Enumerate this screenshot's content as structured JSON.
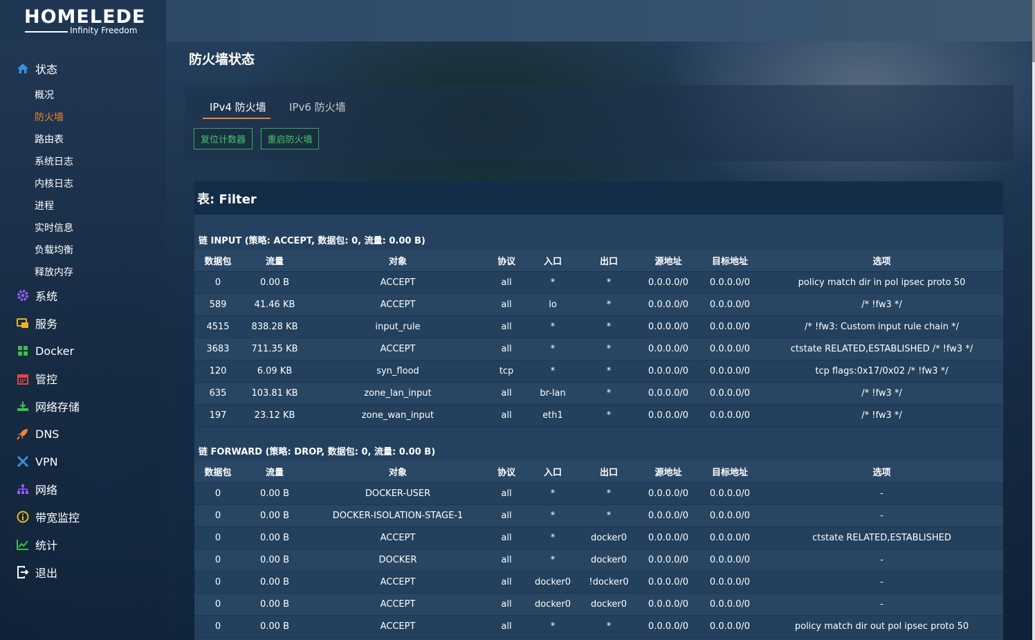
{
  "brand": {
    "name": "HOMELEDE",
    "tagline": "Infinity Freedom"
  },
  "sidebar": {
    "status": {
      "label": "状态",
      "items": [
        "概况",
        "防火墙",
        "路由表",
        "系统日志",
        "内核日志",
        "进程",
        "实时信息",
        "负载均衡",
        "释放内存"
      ],
      "active_index": 1
    },
    "menu": [
      {
        "label": "系统",
        "icon": "gear-icon",
        "color": "#9b59ff"
      },
      {
        "label": "服务",
        "icon": "services-icon",
        "color": "#f0b429"
      },
      {
        "label": "Docker",
        "icon": "docker-icon",
        "color": "#3fbf4a"
      },
      {
        "label": "管控",
        "icon": "calendar-icon",
        "color": "#e64545"
      },
      {
        "label": "网络存储",
        "icon": "download-icon",
        "color": "#3fbf4a"
      },
      {
        "label": "DNS",
        "icon": "rocket-icon",
        "color": "#f0852c"
      },
      {
        "label": "VPN",
        "icon": "vpn-icon",
        "color": "#3b8fe0"
      },
      {
        "label": "网络",
        "icon": "network-icon",
        "color": "#9b59ff"
      },
      {
        "label": "带宽监控",
        "icon": "info-circle-icon",
        "color": "#f0b429"
      },
      {
        "label": "统计",
        "icon": "chart-line-icon",
        "color": "#3fbf4a"
      },
      {
        "label": "退出",
        "icon": "logout-icon",
        "color": "#ffffff"
      }
    ]
  },
  "page": {
    "title": "防火墙状态",
    "tabs": [
      "IPv4 防火墙",
      "IPv6 防火墙"
    ],
    "active_tab": 0,
    "buttons": {
      "reset_counters": "复位计数器",
      "restart_firewall": "重启防火墙"
    },
    "table_title": "表: Filter"
  },
  "columns": [
    "数据包",
    "流量",
    "对象",
    "协议",
    "入口",
    "出口",
    "源地址",
    "目标地址",
    "选项"
  ],
  "chains": [
    {
      "title": "链 INPUT (策略: ACCEPT, 数据包: 0, 流量: 0.00 B)",
      "rows": [
        [
          "0",
          "0.00 B",
          "ACCEPT",
          "all",
          "*",
          "*",
          "0.0.0.0/0",
          "0.0.0.0/0",
          "policy match dir in pol ipsec proto 50"
        ],
        [
          "589",
          "41.46 KB",
          "ACCEPT",
          "all",
          "lo",
          "*",
          "0.0.0.0/0",
          "0.0.0.0/0",
          "/* !fw3 */"
        ],
        [
          "4515",
          "838.28 KB",
          "input_rule",
          "all",
          "*",
          "*",
          "0.0.0.0/0",
          "0.0.0.0/0",
          "/* !fw3: Custom input rule chain */"
        ],
        [
          "3683",
          "711.35 KB",
          "ACCEPT",
          "all",
          "*",
          "*",
          "0.0.0.0/0",
          "0.0.0.0/0",
          "ctstate RELATED,ESTABLISHED /* !fw3 */"
        ],
        [
          "120",
          "6.09 KB",
          "syn_flood",
          "tcp",
          "*",
          "*",
          "0.0.0.0/0",
          "0.0.0.0/0",
          "tcp flags:0x17/0x02 /* !fw3 */"
        ],
        [
          "635",
          "103.81 KB",
          "zone_lan_input",
          "all",
          "br-lan",
          "*",
          "0.0.0.0/0",
          "0.0.0.0/0",
          "/* !fw3 */"
        ],
        [
          "197",
          "23.12 KB",
          "zone_wan_input",
          "all",
          "eth1",
          "*",
          "0.0.0.0/0",
          "0.0.0.0/0",
          "/* !fw3 */"
        ]
      ]
    },
    {
      "title": "链 FORWARD (策略: DROP, 数据包: 0, 流量: 0.00 B)",
      "rows": [
        [
          "0",
          "0.00 B",
          "DOCKER-USER",
          "all",
          "*",
          "*",
          "0.0.0.0/0",
          "0.0.0.0/0",
          "-"
        ],
        [
          "0",
          "0.00 B",
          "DOCKER-ISOLATION-STAGE-1",
          "all",
          "*",
          "*",
          "0.0.0.0/0",
          "0.0.0.0/0",
          "-"
        ],
        [
          "0",
          "0.00 B",
          "ACCEPT",
          "all",
          "*",
          "docker0",
          "0.0.0.0/0",
          "0.0.0.0/0",
          "ctstate RELATED,ESTABLISHED"
        ],
        [
          "0",
          "0.00 B",
          "DOCKER",
          "all",
          "*",
          "docker0",
          "0.0.0.0/0",
          "0.0.0.0/0",
          "-"
        ],
        [
          "0",
          "0.00 B",
          "ACCEPT",
          "all",
          "docker0",
          "!docker0",
          "0.0.0.0/0",
          "0.0.0.0/0",
          "-"
        ],
        [
          "0",
          "0.00 B",
          "ACCEPT",
          "all",
          "docker0",
          "docker0",
          "0.0.0.0/0",
          "0.0.0.0/0",
          "-"
        ],
        [
          "0",
          "0.00 B",
          "ACCEPT",
          "all",
          "*",
          "*",
          "0.0.0.0/0",
          "0.0.0.0/0",
          "policy match dir out pol ipsec proto 50"
        ]
      ]
    }
  ]
}
